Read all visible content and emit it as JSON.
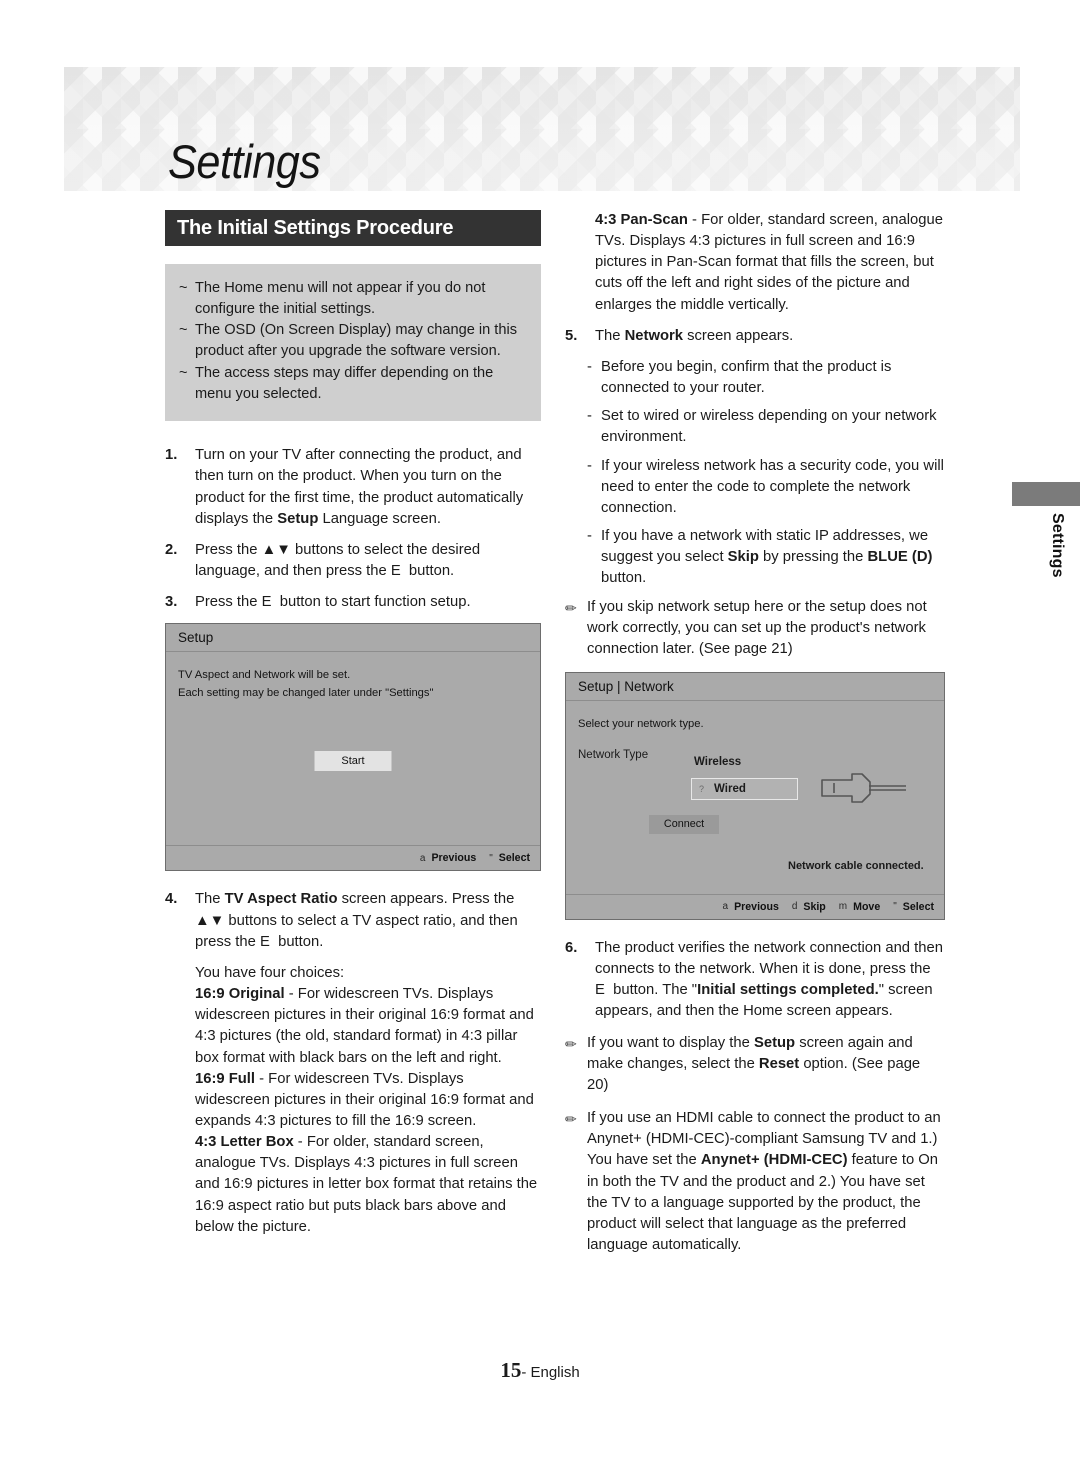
{
  "page": {
    "chapter_title": "Settings",
    "side_tab_label": "Settings",
    "footer_page_number": "15",
    "footer_language": "- English"
  },
  "section": {
    "heading": "The Initial Settings Procedure"
  },
  "notes_box": {
    "bullet_marker": "~",
    "items": [
      "The Home menu will not appear if you do not configure the initial settings.",
      "The OSD (On Screen Display) may change in this product after you upgrade the software version.",
      "The access steps may differ depending on the menu you selected."
    ]
  },
  "left_column": {
    "steps": [
      {
        "number": "1.",
        "text_before": "Turn on your TV after connecting the product, and then turn on the product. When you turn on the product for the first time, the product automatically displays the ",
        "bold": "Setup",
        "text_after": " Language screen."
      },
      {
        "number": "2.",
        "text_before": "Press the ",
        "arrows": "▲▼",
        "text_mid": " buttons to select the desired language, and then press the ",
        "enter_key": "E",
        "text_after": "button."
      },
      {
        "number": "3.",
        "text_before": "Press the ",
        "enter_key": "E",
        "text_after": "button to start function setup."
      }
    ],
    "step4": {
      "number": "4.",
      "lead_before": "The ",
      "lead_bold": "TV Aspect Ratio",
      "lead_mid": " screen appears. Press the ",
      "arrows": "▲▼",
      "lead_mid2": " buttons to select a TV aspect ratio, and then press the ",
      "enter_key": "E",
      "lead_after": "button.",
      "choices_intro": "You have four choices:",
      "choices": [
        {
          "name": "16:9 Original",
          "desc": " - For widescreen TVs. Displays widescreen pictures in their original 16:9 format and 4:3 pictures (the old, standard format) in 4:3 pillar box format with black bars on the left and right."
        },
        {
          "name": "16:9 Full",
          "desc": " - For widescreen TVs. Displays widescreen pictures in their original 16:9 format and expands 4:3 pictures to fill the 16:9 screen."
        },
        {
          "name": "4:3 Letter Box",
          "desc": " - For older, standard screen, analogue TVs. Displays 4:3 pictures in full screen and 16:9 pictures in letter box format that retains the 16:9 aspect ratio but puts black bars above and below the picture."
        }
      ]
    }
  },
  "setup_screen": {
    "header": "Setup",
    "line1": "TV Aspect and Network will be set.",
    "line2": "Each setting may be changed later under \"Settings\"",
    "start_button": "Start",
    "footer": [
      {
        "key": "a",
        "label": "Previous"
      },
      {
        "key": "\"",
        "label": "Select"
      }
    ]
  },
  "right_column": {
    "pan_scan": {
      "name": "4:3 Pan-Scan",
      "desc": " - For older, standard screen, analogue TVs. Displays 4:3 pictures in full screen and 16:9 pictures in Pan-Scan format that fills the screen, but cuts off the left and right sides of the picture and enlarges the middle vertically."
    },
    "step5": {
      "number": "5.",
      "text_before": "The ",
      "bold": "Network",
      "text_after": " screen appears.",
      "subitems": [
        {
          "dash": "-",
          "text": "Before you begin, confirm that the product is connected to your router."
        },
        {
          "dash": "-",
          "text": "Set to wired or wireless depending on your network environment."
        },
        {
          "dash": "-",
          "text": "If your wireless network has a security code, you will need to enter the code to complete the network connection."
        },
        {
          "dash": "-",
          "text_a": "If you have a network with static IP addresses, we suggest you select ",
          "bold_a": "Skip",
          "text_b": " by pressing the ",
          "bold_b": "BLUE (D)",
          "text_c": " button."
        }
      ]
    },
    "tip1": "If you skip network setup here or the setup does not work correctly, you can set up the product's network connection later. (See page 21)",
    "step6": {
      "number": "6.",
      "text_a": "The product verifies the network connection and then connects to the network. When it is done, press the ",
      "enter_key": "E",
      "text_b": "button. The \"",
      "bold": "Initial settings completed.",
      "text_c": "\" screen appears, and then the Home screen appears."
    },
    "tip2": {
      "text_a": "If you want to display the ",
      "bold_a": "Setup",
      "text_b": " screen again and make changes, select the ",
      "bold_b": "Reset",
      "text_c": " option. (See page 20)"
    },
    "tip3": {
      "text_a": "If you use an HDMI cable to connect the product to an Anynet+ (HDMI-CEC)-compliant Samsung TV and 1.) You have set the ",
      "bold_a": "Anynet+ (HDMI-CEC)",
      "text_b": " feature to On in both the TV and the product and 2.) You have set the TV to a language supported by the product, the product will select that language as the preferred language automatically."
    }
  },
  "network_screen": {
    "header": "Setup | Network",
    "instruction": "Select your network type.",
    "type_label": "Network Type",
    "option_wireless": "Wireless",
    "option_wired": "Wired",
    "wired_marker": "?",
    "connect_button": "Connect",
    "status": "Network cable connected.",
    "footer": [
      {
        "key": "a",
        "label": "Previous"
      },
      {
        "key": "d",
        "label": "Skip"
      },
      {
        "key": "m",
        "label": "Move"
      },
      {
        "key": "\"",
        "label": "Select"
      }
    ]
  },
  "colors": {
    "section_bar": "#333333",
    "note_box": "#cfcfcf",
    "osd_background": "#aaaaaa",
    "side_tab": "#7b7b7b"
  }
}
